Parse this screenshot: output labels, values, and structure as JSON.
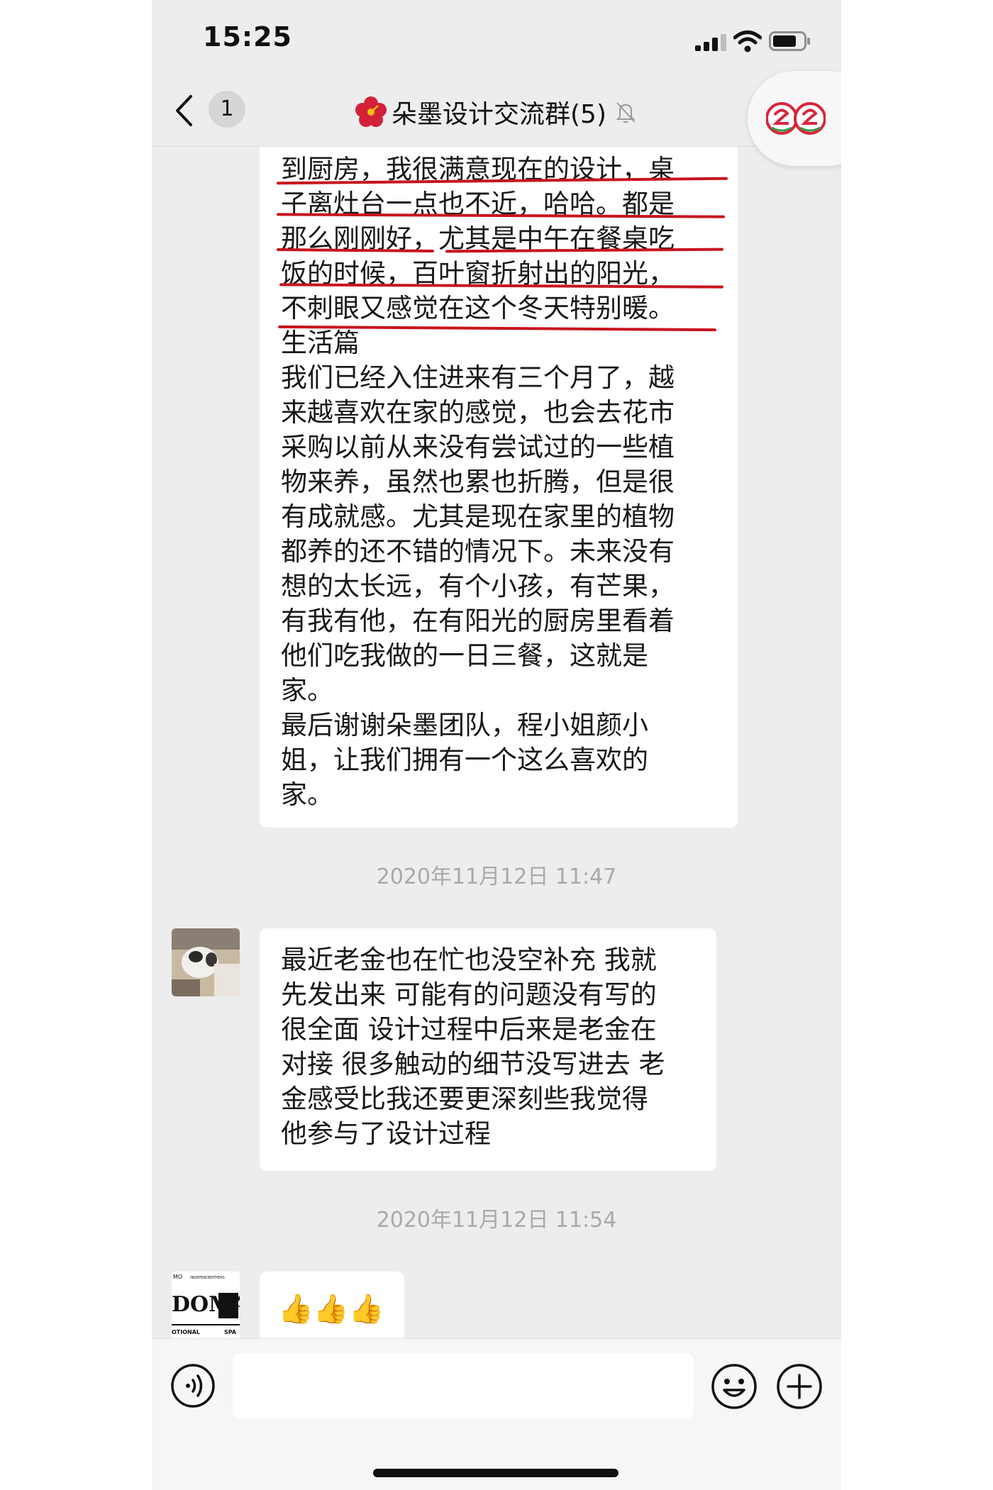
{
  "status_bar": {
    "time": "15:25"
  },
  "nav": {
    "back_badge": "1",
    "title": "朵墨设计交流群(5)"
  },
  "messages": [
    {
      "kind": "text",
      "lines": [
        "到厨房，我很满意现在的设计，桌",
        "子离灶台一点也不近，哈哈。都是",
        "那么刚刚好，尤其是中午在餐桌吃",
        "饭的时候，百叶窗折射出的阳光，",
        "不刺眼又感觉在这个冬天特别暖。",
        "生活篇",
        "我们已经入住进来有三个月了，越",
        "来越喜欢在家的感觉，也会去花市",
        "采购以前从来没有尝试过的一些植",
        "物来养，虽然也累也折腾，但是很",
        "有成就感。尤其是现在家里的植物",
        "都养的还不错的情况下。未来没有",
        "想的太长远，有个小孩，有芒果，",
        "有我有他，在有阳光的厨房里看着",
        "他们吃我做的一日三餐，这就是",
        "家。",
        "最后谢谢朵墨团队，程小姐颜小",
        "姐，让我们拥有一个这么喜欢的",
        "家。"
      ]
    },
    {
      "kind": "timestamp",
      "text": "2020年11月12日 11:47"
    },
    {
      "kind": "text",
      "lines": [
        "最近老金也在忙也没空补充 我就",
        "先发出来 可能有的问题没有写的",
        "很全面 设计过程中后来是老金在",
        "对接 很多触动的细节没写进去 老",
        "金感受比我还要更深刻些我觉得",
        "他参与了设计过程"
      ]
    },
    {
      "kind": "timestamp",
      "text": "2020年11月12日 11:54"
    },
    {
      "kind": "emoji",
      "text": "👍👍👍"
    }
  ],
  "avatar2_text": [
    "MO",
    "INDEPENDENTPERS",
    "DOMA",
    "OTIONAL",
    "SPA"
  ],
  "colors": {
    "underline": "#c8141e",
    "background": "#ededed",
    "bubble": "#ffffff",
    "timestamp": "#a9a9a9"
  },
  "icons": [
    "signal-icon",
    "wifi-icon",
    "battery-icon",
    "back-chevron-icon",
    "flower-icon",
    "mute-bell-icon",
    "voice-icon",
    "emoji-icon",
    "plus-icon"
  ]
}
